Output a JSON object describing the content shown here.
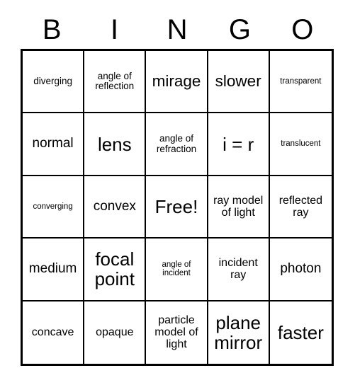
{
  "header": {
    "letters": [
      "B",
      "I",
      "N",
      "G",
      "O"
    ]
  },
  "grid": {
    "rows": 5,
    "columns": 5,
    "free_space_index": 12,
    "border_color": "#000000",
    "background_color": "#ffffff",
    "cells": [
      {
        "text": "diverging",
        "size": "sm"
      },
      {
        "text": "angle of reflection",
        "size": "sm"
      },
      {
        "text": "mirage",
        "size": "xl"
      },
      {
        "text": "slower",
        "size": "xl"
      },
      {
        "text": "transparent",
        "size": "xs"
      },
      {
        "text": "normal",
        "size": "lg"
      },
      {
        "text": "lens",
        "size": "xxl"
      },
      {
        "text": "angle of refraction",
        "size": "sm"
      },
      {
        "text": "i = r",
        "size": "xxl"
      },
      {
        "text": "translucent",
        "size": "xs"
      },
      {
        "text": "converging",
        "size": "xs"
      },
      {
        "text": "convex",
        "size": "lg"
      },
      {
        "text": "Free!",
        "size": "xxl"
      },
      {
        "text": "ray model of light",
        "size": "md"
      },
      {
        "text": "reflected ray",
        "size": "md"
      },
      {
        "text": "medium",
        "size": "lg"
      },
      {
        "text": "focal point",
        "size": "xxl"
      },
      {
        "text": "angle of incident",
        "size": "xs"
      },
      {
        "text": "incident ray",
        "size": "md"
      },
      {
        "text": "photon",
        "size": "lg"
      },
      {
        "text": "concave",
        "size": "md"
      },
      {
        "text": "opaque",
        "size": "md"
      },
      {
        "text": "particle model of light",
        "size": "md"
      },
      {
        "text": "plane mirror",
        "size": "xxl"
      },
      {
        "text": "faster",
        "size": "xxl"
      }
    ]
  }
}
